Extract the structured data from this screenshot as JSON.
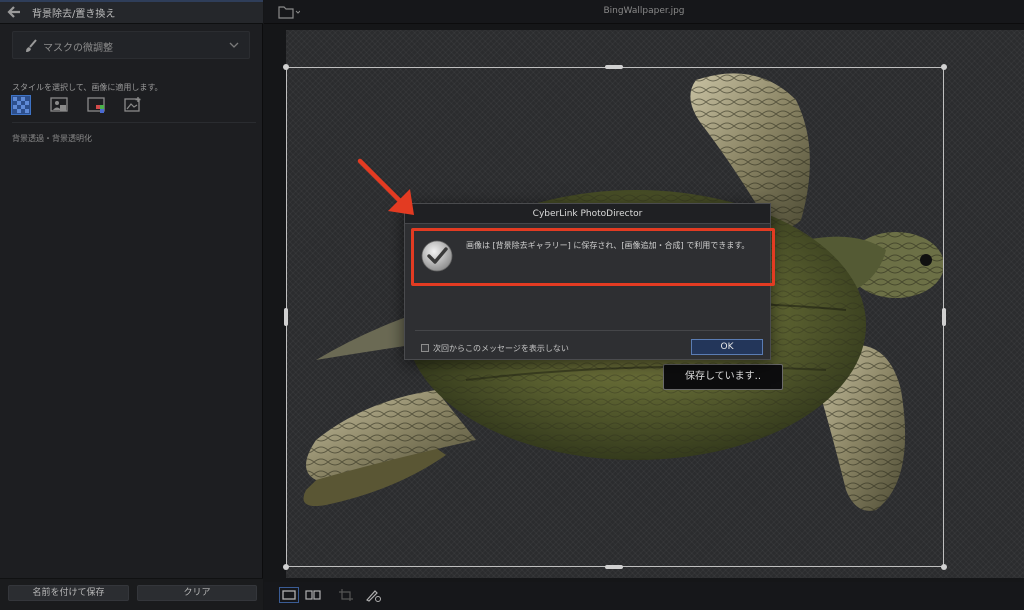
{
  "left_panel": {
    "header_title": "背景除去/置き換え",
    "mask_dropdown": {
      "label": "マスクの微調整",
      "icon": "brush-icon"
    },
    "style_hint": "スタイルを選択して、画像に適用します。",
    "style_options": [
      "transparent-style-icon",
      "person-bg-style-icon",
      "color-bg-style-icon",
      "image-bg-style-icon"
    ],
    "bg_mode": "背景透過・背景透明化",
    "buttons": {
      "save_as": "名前を付けて保存",
      "clear": "クリア"
    }
  },
  "workspace": {
    "filename": "BingWallpaper.jpg",
    "saving_text": "保存しています.."
  },
  "dialog": {
    "title": "CyberLink PhotoDirector",
    "message": "画像は [背景除去ギャラリー] に保存され、[画像追加・合成] で利用できます。",
    "dont_show_label": "次回からこのメッセージを表示しない",
    "ok_label": "OK"
  },
  "colors": {
    "highlight": "#e33b22",
    "ok_button": "#23365a",
    "selection_accent": "#3e73c6"
  }
}
